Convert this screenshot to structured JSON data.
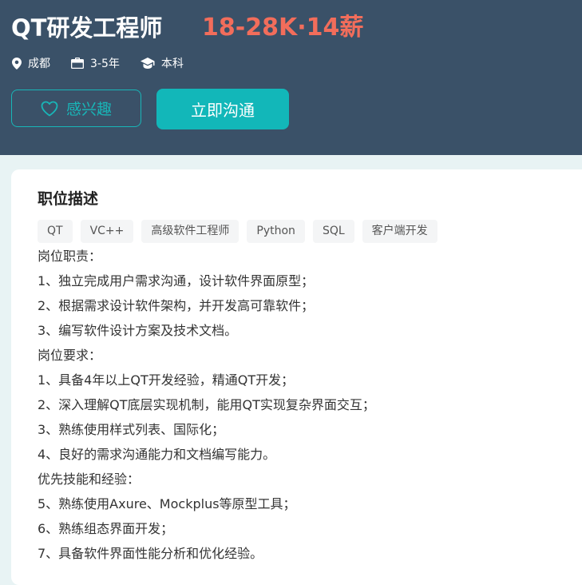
{
  "job": {
    "title": "QT研发工程师",
    "salary": "18-28K·14薪",
    "location": "成都",
    "experience": "3-5年",
    "education": "本科"
  },
  "actions": {
    "interest_label": "感兴趣",
    "chat_label": "立即沟通"
  },
  "description": {
    "heading": "职位描述",
    "tags": [
      "QT",
      "VC++",
      "高级软件工程师",
      "Python",
      "SQL",
      "客户端开发"
    ],
    "lines": [
      "岗位职责：",
      "1、独立完成用户需求沟通，设计软件界面原型；",
      "2、根据需求设计软件架构，并开发高可靠软件；",
      "3、编写软件设计方案及技术文档。",
      "岗位要求：",
      "1、具备4年以上QT开发经验，精通QT开发；",
      "2、深入理解QT底层实现机制，能用QT实现复杂界面交互；",
      "3、熟练使用样式列表、国际化；",
      "4、良好的需求沟通能力和文档编写能力。",
      "优先技能和经验：",
      "5、熟练使用Axure、Mockplus等原型工具；",
      "6、熟练组态界面开发；",
      "7、具备软件界面性能分析和优化经验。"
    ]
  },
  "icons": {
    "location": "location-pin-icon",
    "experience": "briefcase-icon",
    "education": "graduation-cap-icon",
    "interest": "heart-outline-icon"
  },
  "colors": {
    "header_bg": "#3a5168",
    "salary": "#f26d5b",
    "accent": "#12b7b9",
    "page_bg": "#e8f3f4"
  }
}
